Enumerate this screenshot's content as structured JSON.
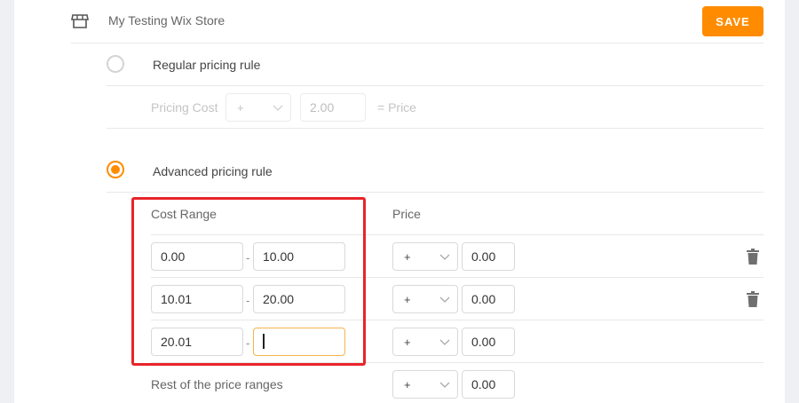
{
  "header": {
    "store_name": "My Testing Wix Store",
    "save_label": "SAVE"
  },
  "regular_rule": {
    "label": "Regular pricing rule",
    "pricing_cost_label": "Pricing Cost",
    "operator": "+",
    "value": "2.00",
    "equals_price_label": "= Price"
  },
  "advanced_rule": {
    "label": "Advanced pricing rule",
    "cost_range_header": "Cost Range",
    "price_header": "Price",
    "separator": "-",
    "rows": [
      {
        "from": "0.00",
        "to": "10.00",
        "operator": "+",
        "price": "0.00"
      },
      {
        "from": "10.01",
        "to": "20.00",
        "operator": "+",
        "price": "0.00"
      },
      {
        "from": "20.01",
        "to": "",
        "operator": "+",
        "price": "0.00"
      }
    ],
    "rest_label": "Rest of the price ranges",
    "rest_operator": "+",
    "rest_price": "0.00"
  },
  "colors": {
    "accent": "#ff8c00",
    "highlight": "#e8232a"
  }
}
